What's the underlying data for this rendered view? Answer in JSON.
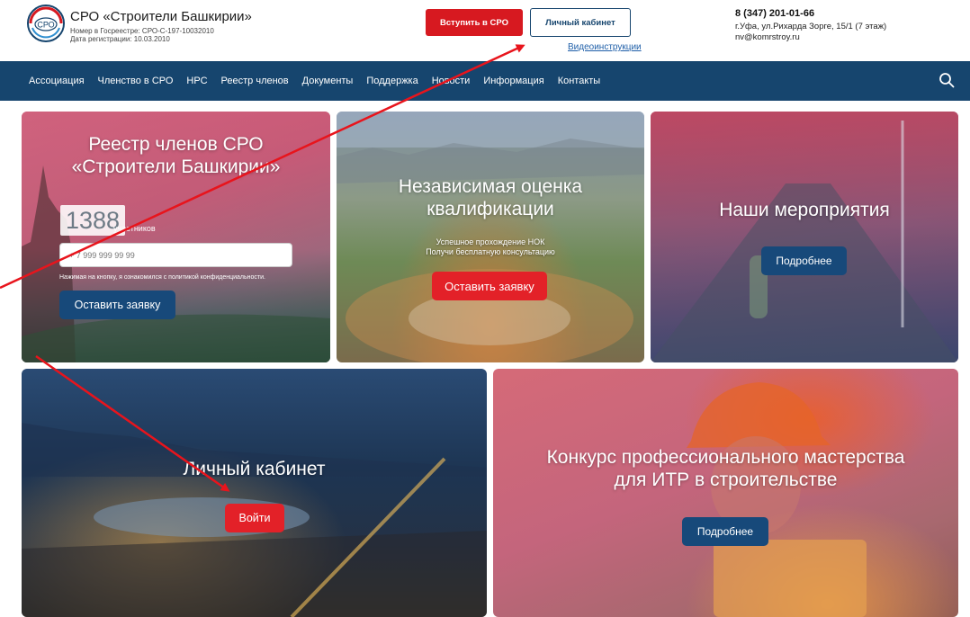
{
  "header": {
    "brand_title": "СРО «Строители Башкирии»",
    "registry_number": "Номер в Госреестре: СРО-С-197-10032010",
    "registration_date": "Дата регистрации: 10.03.2010",
    "logo_text": "СРО",
    "join_button": "Вступить в СРО",
    "cabinet_button": "Личный кабинет",
    "video_link": "Видеоинструкции",
    "phone": "8 (347) 201-01-66",
    "address": "г.Уфа, ул.Рихарда Зорге, 15/1 (7 этаж)",
    "email": "nv@komrstroy.ru"
  },
  "nav": {
    "items": [
      "Ассоциация",
      "Членство в СРО",
      "НРС",
      "Реестр членов",
      "Документы",
      "Поддержка",
      "Новости",
      "Информация",
      "Контакты"
    ],
    "search_icon": "search-icon"
  },
  "tiles": {
    "registry": {
      "title_line1": "Реестр членов СРО",
      "title_line2": "«Строители Башкирии»",
      "count": "1388",
      "count_label": "участников",
      "phone_placeholder": "+ 7 999 999 99 99",
      "policy_text": "Нажимая на кнопку, я ознакомился с политикой конфиденциальности.",
      "button": "Оставить заявку"
    },
    "assessment": {
      "title_line1": "Независимая оценка",
      "title_line2": "квалификации",
      "subtitle_line1": "Успешное прохождение НОК",
      "subtitle_line2": "Получи бесплатную консультацию",
      "button": "Оставить заявку"
    },
    "events": {
      "title": "Наши мероприятия",
      "button": "Подробнее"
    },
    "cabinet": {
      "title": "Личный кабинет",
      "button": "Войти"
    },
    "contest": {
      "title_line1": "Конкурс профессионального мастерства",
      "title_line2": "для ИТР в строительстве",
      "button": "Подробнее"
    }
  },
  "colors": {
    "brand_blue": "#16456e",
    "accent_red": "#d71920",
    "annotation_arrow": "#e8141c"
  }
}
